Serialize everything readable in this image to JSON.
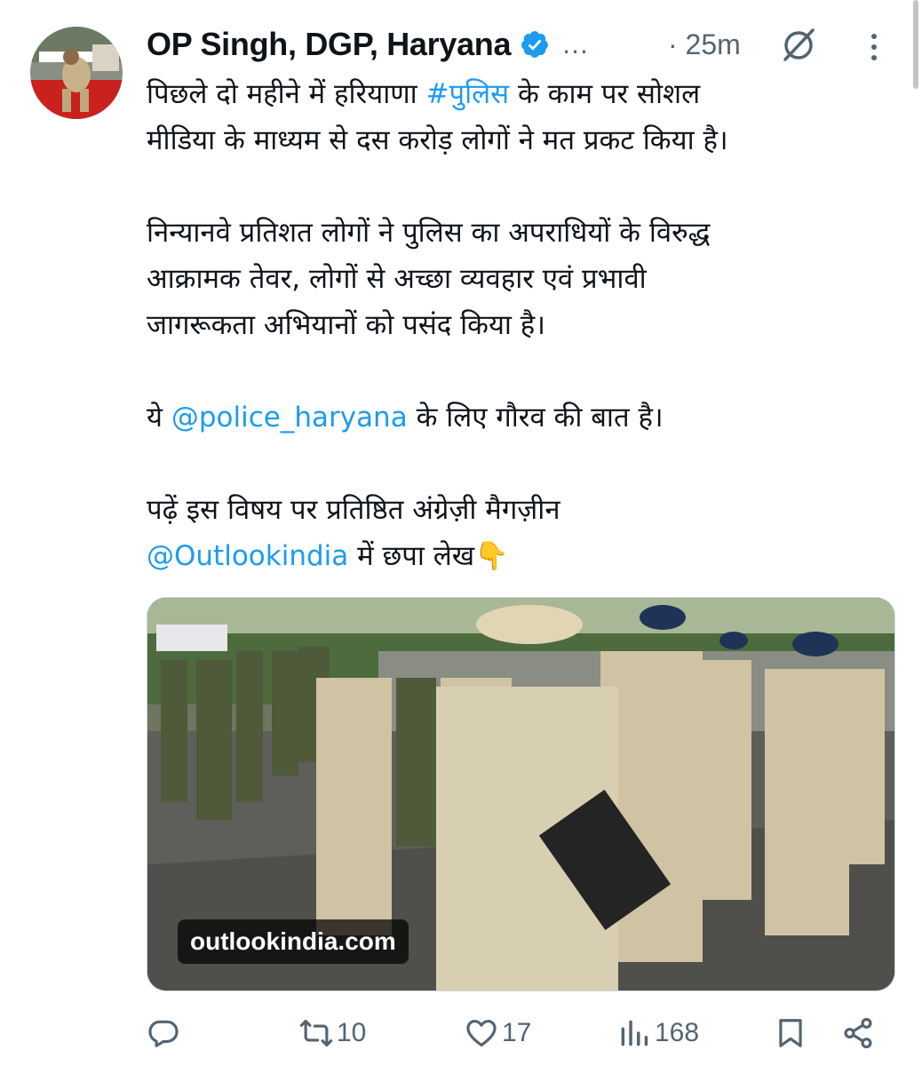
{
  "tweet": {
    "author_name": "OP Singh, DGP, Haryana",
    "handle_truncated": "...",
    "timestamp": "· 25m",
    "paragraphs": [
      {
        "lines": [
          [
            {
              "t": "पिछले दो महीने में हरियाणा "
            },
            {
              "t": "#पुलिस",
              "link": true
            },
            {
              "t": " के काम पर सोशल"
            }
          ],
          [
            {
              "t": "मीडिया के माध्यम से  दस करोड़ लोगों ने मत प्रकट किया है।"
            }
          ]
        ]
      },
      {
        "lines": [
          [
            {
              "t": "निन्यानवे प्रतिशत लोगों ने पुलिस का अपराधियों के विरुद्ध"
            }
          ],
          [
            {
              "t": "आक्रामक तेवर, लोगों से अच्छा व्यवहार एवं प्रभावी"
            }
          ],
          [
            {
              "t": "जागरूकता अभियानों को पसंद किया है।"
            }
          ]
        ]
      },
      {
        "lines": [
          [
            {
              "t": "ये "
            },
            {
              "t": "@police_haryana",
              "link": true
            },
            {
              "t": " के लिए गौरव की बात है।"
            }
          ]
        ]
      },
      {
        "lines": [
          [
            {
              "t": "पढ़ें इस विषय पर प्रतिष्ठित अंग्रेज़ी मैगज़ीन"
            }
          ],
          [
            {
              "t": "@Outlookindia",
              "link": true
            },
            {
              "t": " में छपा लेख👇"
            }
          ]
        ]
      }
    ],
    "media": {
      "source_badge": "outlookindia.com"
    }
  },
  "actions": {
    "reply": {
      "icon": "reply-icon",
      "count": ""
    },
    "retweet": {
      "icon": "retweet-icon",
      "count": "10"
    },
    "like": {
      "icon": "heart-icon",
      "count": "17"
    },
    "views": {
      "icon": "views-icon",
      "count": "168"
    },
    "bookmark": {
      "icon": "bookmark-icon"
    },
    "share": {
      "icon": "share-icon"
    }
  },
  "colors": {
    "link": "#1d9bf0",
    "text": "#0f1419",
    "muted": "#536471"
  }
}
